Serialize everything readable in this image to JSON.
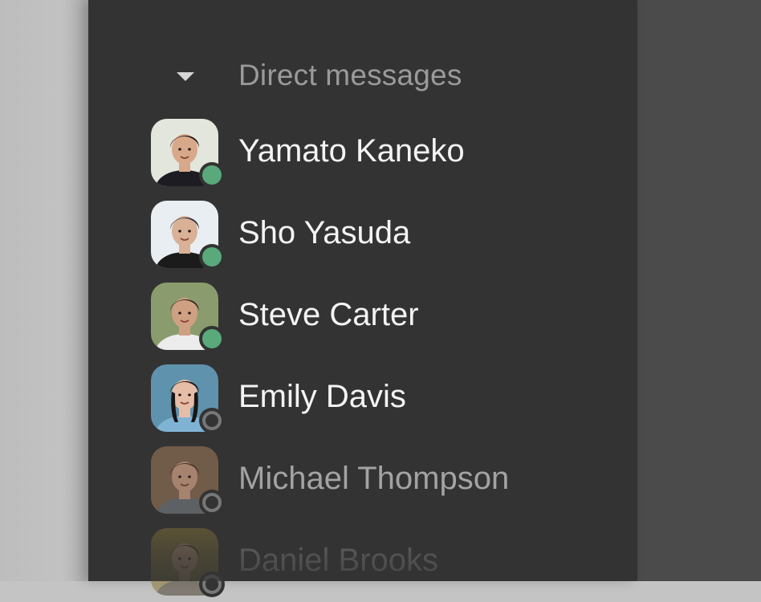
{
  "section": {
    "title": "Direct messages",
    "collapse_icon": "caret-down-icon"
  },
  "direct_messages": [
    {
      "name": "Yamato Kaneko",
      "status": "online",
      "avatar_colors": {
        "bg": "#e3e6dc",
        "skin": "#d7a98a",
        "hair": "#2a1a18",
        "shirt": "#1c1c22"
      }
    },
    {
      "name": "Sho Yasuda",
      "status": "online",
      "avatar_colors": {
        "bg": "#e9eef2",
        "skin": "#d9b197",
        "hair": "#2b3346",
        "shirt": "#1b1b1b"
      }
    },
    {
      "name": "Steve Carter",
      "status": "online",
      "avatar_colors": {
        "bg": "#8a9c6d",
        "skin": "#d0a083",
        "hair": "#3a2a22",
        "shirt": "#ececec"
      }
    },
    {
      "name": "Emily Davis",
      "status": "offline",
      "avatar_colors": {
        "bg": "#5f93ad",
        "skin": "#e6bda6",
        "hair": "#1a1414",
        "shirt": "#7fb3d4"
      }
    },
    {
      "name": "Michael Thompson",
      "status": "offline",
      "avatar_colors": {
        "bg": "#8a6b52",
        "skin": "#d2a285",
        "hair": "#5a3b28",
        "shirt": "#6f7478"
      }
    },
    {
      "name": "Daniel Brooks",
      "status": "offline",
      "avatar_colors": {
        "bg": "#8c7a3a",
        "skin": "#caa07c",
        "hair": "#3f2f1e",
        "shirt": "#4a4030"
      }
    }
  ],
  "colors": {
    "sidebar_bg": "#333333",
    "online": "#5aa97a",
    "offline": "#777777"
  }
}
